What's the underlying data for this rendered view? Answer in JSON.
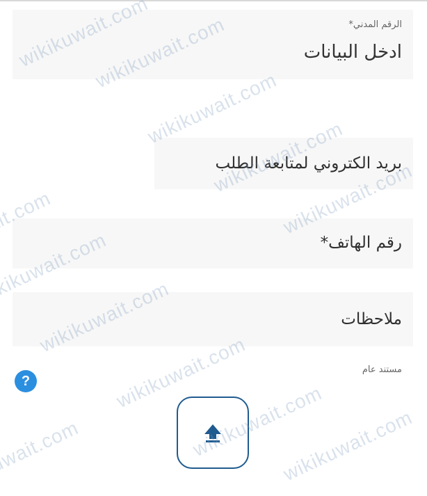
{
  "colors": {
    "accent": "#1f5b8f",
    "help": "#2b8fe0",
    "field_bg": "#f7f7f7"
  },
  "form": {
    "civil_id": {
      "label": "الرقم المدني*",
      "placeholder": "ادخل البيانات"
    },
    "email": {
      "label": "بريد الكتروني لمتابعة الطلب"
    },
    "phone": {
      "label": "رقم الهاتف*"
    },
    "notes": {
      "label": "ملاحظات"
    },
    "document": {
      "label": "مستند عام",
      "help_icon": "question-circle-icon",
      "help_text": "?",
      "upload_icon": "upload-arrow-icon"
    }
  },
  "watermark": {
    "text": "wikikuwait.com"
  }
}
